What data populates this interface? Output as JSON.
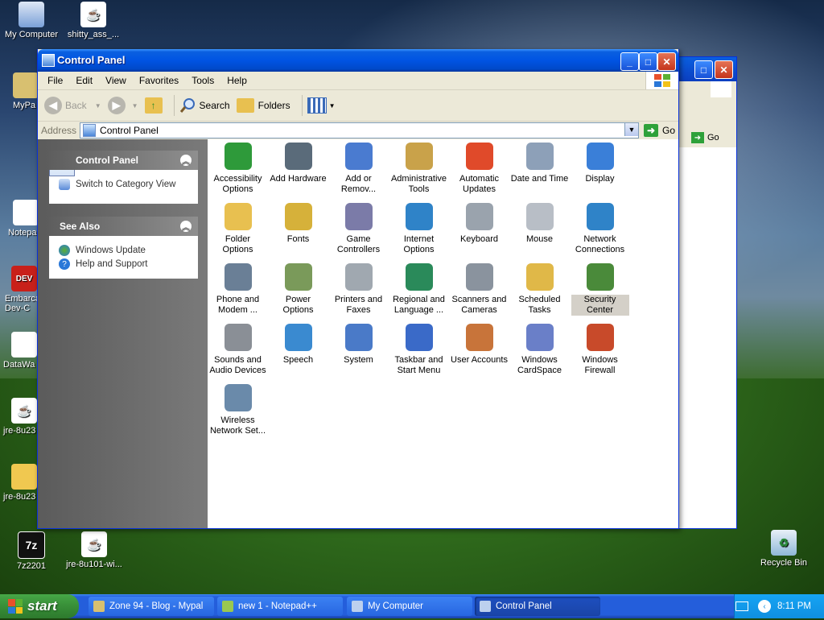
{
  "desktop": {
    "icons": [
      {
        "label": "My Computer"
      },
      {
        "label": "shitty_ass_..."
      },
      {
        "label": "MyPa"
      },
      {
        "label": "Notepa"
      },
      {
        "label": "Embarca Dev-C"
      },
      {
        "label": "DataWa"
      },
      {
        "label": "jre-8u23"
      },
      {
        "label": "jre-8u23"
      },
      {
        "label": "7z2201"
      },
      {
        "label": "jre-8u101-wi..."
      },
      {
        "label": "Recycle Bin"
      }
    ],
    "bg_window": {
      "go_label": "Go"
    }
  },
  "window": {
    "title": "Control Panel",
    "buttons": {
      "minimize": "_",
      "maximize": "□",
      "close": "✕"
    }
  },
  "menu": [
    "File",
    "Edit",
    "View",
    "Favorites",
    "Tools",
    "Help"
  ],
  "toolbar": {
    "back": "Back",
    "search": "Search",
    "folders": "Folders"
  },
  "address": {
    "label": "Address",
    "value": "Control Panel",
    "go": "Go"
  },
  "sidebar": {
    "control_panel": {
      "title": "Control Panel",
      "link": "Switch to Category View"
    },
    "see_also": {
      "title": "See Also",
      "links": [
        "Windows Update",
        "Help and Support"
      ]
    }
  },
  "items": [
    {
      "label": "Accessibility Options",
      "icon": "accessibility-icon",
      "color": "#2e9a3a"
    },
    {
      "label": "Add Hardware",
      "icon": "hardware-icon",
      "color": "#5a6b7a"
    },
    {
      "label": "Add or Remov...",
      "icon": "add-remove-icon",
      "color": "#4a7bd0"
    },
    {
      "label": "Administrative Tools",
      "icon": "admin-tools-icon",
      "color": "#c9a24a"
    },
    {
      "label": "Automatic Updates",
      "icon": "windows-logo-icon",
      "color": "#e04a2a"
    },
    {
      "label": "Date and Time",
      "icon": "clock-icon",
      "color": "#8da0b8"
    },
    {
      "label": "Display",
      "icon": "display-icon",
      "color": "#3a7fd8"
    },
    {
      "label": "Folder Options",
      "icon": "folder-icon",
      "color": "#e8c050"
    },
    {
      "label": "Fonts",
      "icon": "fonts-icon",
      "color": "#d6b13a"
    },
    {
      "label": "Game Controllers",
      "icon": "gamepad-icon",
      "color": "#7b7ba8"
    },
    {
      "label": "Internet Options",
      "icon": "globe-icon",
      "color": "#2f83c8"
    },
    {
      "label": "Keyboard",
      "icon": "keyboard-icon",
      "color": "#9aa3ad"
    },
    {
      "label": "Mouse",
      "icon": "mouse-icon",
      "color": "#b8bec6"
    },
    {
      "label": "Network Connections",
      "icon": "network-icon",
      "color": "#2f83c8"
    },
    {
      "label": "Phone and Modem ...",
      "icon": "phone-icon",
      "color": "#6a7f96"
    },
    {
      "label": "Power Options",
      "icon": "power-icon",
      "color": "#7a9a5a"
    },
    {
      "label": "Printers and Faxes",
      "icon": "printer-icon",
      "color": "#a0a8b0"
    },
    {
      "label": "Regional and Language ...",
      "icon": "globe-icon",
      "color": "#2a8a5a"
    },
    {
      "label": "Scanners and Cameras",
      "icon": "scanner-icon",
      "color": "#8a939e"
    },
    {
      "label": "Scheduled Tasks",
      "icon": "scheduled-tasks-icon",
      "color": "#e0b848"
    },
    {
      "label": "Security Center",
      "icon": "shield-icon",
      "color": "#4a8a3a"
    },
    {
      "label": "Sounds and Audio Devices",
      "icon": "speaker-icon",
      "color": "#8a8f96"
    },
    {
      "label": "Speech",
      "icon": "speech-icon",
      "color": "#3a8ad0"
    },
    {
      "label": "System",
      "icon": "system-icon",
      "color": "#4a7ac8"
    },
    {
      "label": "Taskbar and Start Menu",
      "icon": "taskbar-icon",
      "color": "#3a6ac8"
    },
    {
      "label": "User Accounts",
      "icon": "users-icon",
      "color": "#c8743a"
    },
    {
      "label": "Windows CardSpace",
      "icon": "cardspace-icon",
      "color": "#6a7fc8"
    },
    {
      "label": "Windows Firewall",
      "icon": "firewall-icon",
      "color": "#c84a2a"
    },
    {
      "label": "Wireless Network Set...",
      "icon": "wireless-icon",
      "color": "#6a8aaa"
    }
  ],
  "taskbar": {
    "start": "start",
    "tasks": [
      "Zone 94 - Blog - Mypal",
      "new 1 - Notepad++",
      "My Computer",
      "Control Panel"
    ],
    "time": "8:11 PM"
  }
}
